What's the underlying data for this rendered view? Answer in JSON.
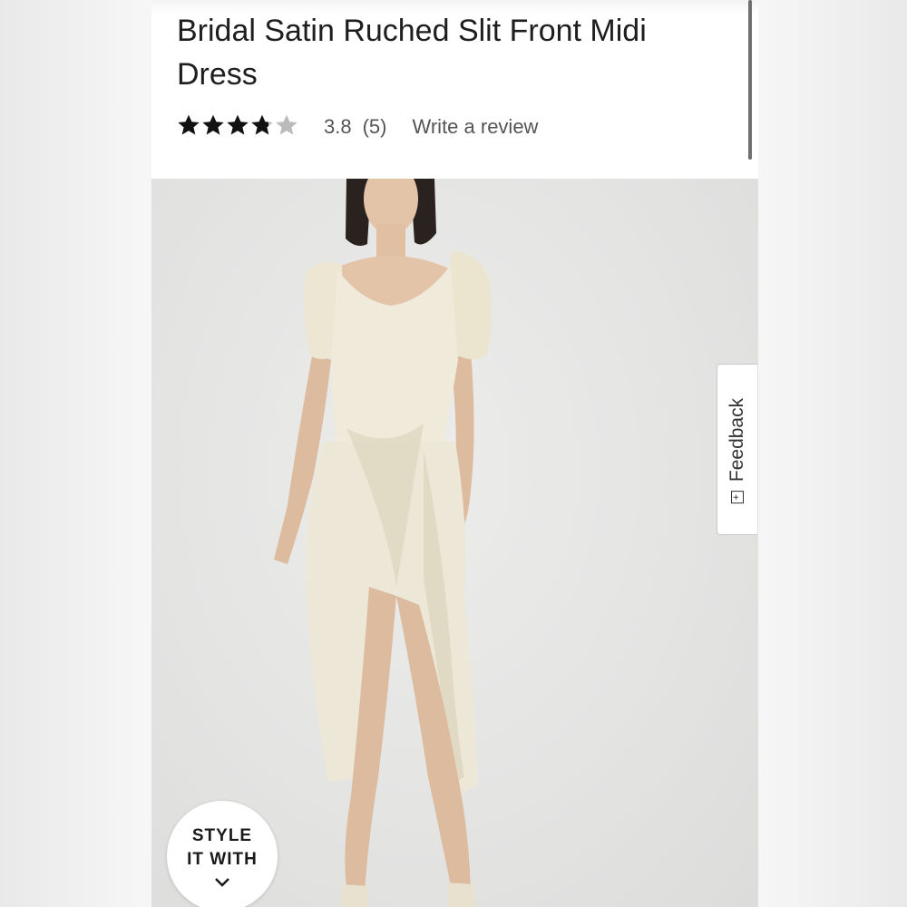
{
  "product": {
    "title": "Bridal Satin Ruched Slit Front Midi Dress",
    "rating_value": "3.8",
    "review_count": "(5)",
    "rating_stars": 3.8,
    "rating_max": 5,
    "write_review_label": "Write a review"
  },
  "feedback": {
    "label": "Feedback",
    "icon": "feedback-plus-icon"
  },
  "style_it_with": {
    "line1": "STYLE",
    "line2": "IT WITH",
    "icon": "chevron-down-icon"
  },
  "colors": {
    "star_filled": "#111111",
    "star_empty": "#bbbbbb",
    "dress": "#ece7d6",
    "skin": "#e3c4a8"
  }
}
